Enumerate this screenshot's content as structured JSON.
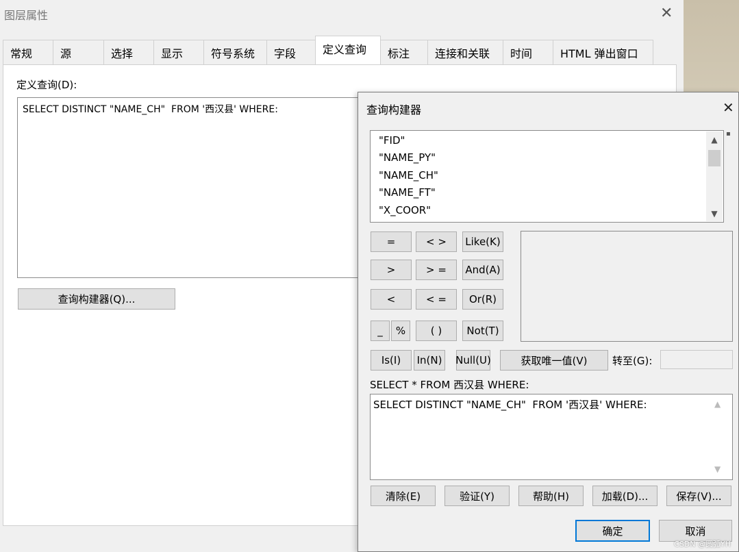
{
  "layer_dialog": {
    "title": "图层属性",
    "tabs": [
      "常规",
      "源",
      "选择",
      "显示",
      "符号系统",
      "字段",
      "定义查询",
      "标注",
      "连接和关联",
      "时间",
      "HTML 弹出窗口"
    ],
    "active_tab": "定义查询",
    "definition_query_label": "定义查询(D):",
    "definition_query_text": "SELECT DISTINCT \"NAME_CH\"  FROM '西汉县' WHERE:",
    "query_builder_button": "查询构建器(Q)..."
  },
  "query_builder": {
    "title": "查询构建器",
    "fields": [
      "\"FID\"",
      "\"NAME_PY\"",
      "\"NAME_CH\"",
      "\"NAME_FT\"",
      "\"X_COOR\""
    ],
    "operators": {
      "eq": "=",
      "neq": "< >",
      "like": "Like(K)",
      "gt": ">",
      "gte": "> =",
      "and": "And(A)",
      "lt": "<",
      "lte": "< =",
      "or": "Or(R)",
      "underscore": "_",
      "percent": "%",
      "parens": "( )",
      "not": "Not(T)",
      "is": "Is(I)",
      "in": "In(N)",
      "null": "Null(U)"
    },
    "get_unique_values": "获取唯一值(V)",
    "goto_label": "转至(G):",
    "select_prefix": "SELECT * FROM 西汉县 WHERE:",
    "sql_text": "SELECT DISTINCT \"NAME_CH\"  FROM '西汉县' WHERE:",
    "clear": "清除(E)",
    "verify": "验证(Y)",
    "help": "帮助(H)",
    "load": "加载(D)...",
    "save": "保存(V)...",
    "ok": "确定",
    "cancel": "取消"
  },
  "watermark": "CSDN @圆弧YH"
}
